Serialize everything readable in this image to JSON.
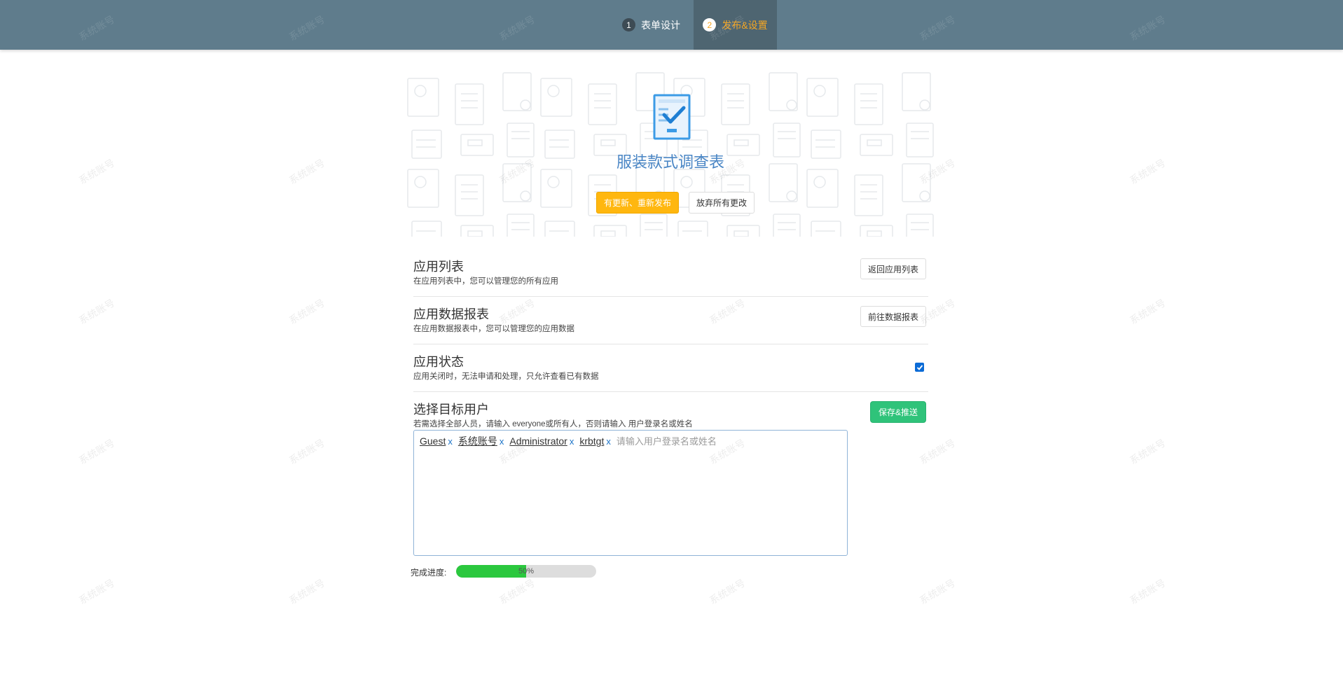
{
  "nav": {
    "steps": [
      {
        "number": "1",
        "label": "表单设计"
      },
      {
        "number": "2",
        "label": "发布&设置"
      }
    ],
    "active_color": "#f5a623",
    "bar_color": "#5f7c8c"
  },
  "header": {
    "form_title": "服装款式调查表",
    "publish_label": "有更新、重新发布",
    "discard_label": "放弃所有更改"
  },
  "sections": {
    "app_list": {
      "title": "应用列表",
      "desc": "在应用列表中，您可以管理您的所有应用",
      "button": "返回应用列表"
    },
    "app_report": {
      "title": "应用数据报表",
      "desc": "在应用数据报表中，您可以管理您的应用数据",
      "button": "前往数据报表"
    },
    "app_status": {
      "title": "应用状态",
      "desc": "应用关闭时，无法申请和处理，只允许查看已有数据",
      "checked": true
    },
    "target_users": {
      "title": "选择目标用户",
      "desc": "若需选择全部人员，请输入 everyone或所有人，否则请输入 用户登录名或姓名",
      "button": "保存&推送",
      "users": [
        "Guest",
        "系统账号",
        "Administrator",
        "krbtgt"
      ],
      "remove_symbol": "x",
      "placeholder": "请输入用户登录名或姓名"
    }
  },
  "progress": {
    "label": "完成进度:",
    "value_text": "50%",
    "value": 50
  },
  "watermark": "系统账号"
}
